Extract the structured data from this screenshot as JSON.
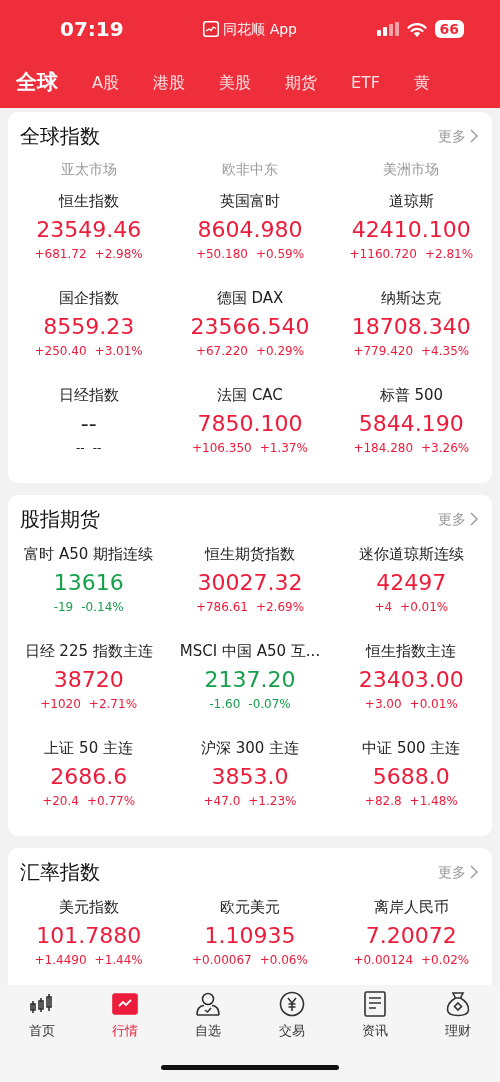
{
  "status_bar": {
    "time": "07:19",
    "app": "同花顺 App",
    "battery": "66"
  },
  "market_tabs": [
    {
      "label": "全球",
      "selected": true
    },
    {
      "label": "A股",
      "selected": false
    },
    {
      "label": "港股",
      "selected": false
    },
    {
      "label": "美股",
      "selected": false
    },
    {
      "label": "期货",
      "selected": false
    },
    {
      "label": "ETF",
      "selected": false
    },
    {
      "label": "黄",
      "selected": false
    }
  ],
  "sections": [
    {
      "title": "全球指数",
      "more": "更多",
      "regions": [
        "亚太市场",
        "欧非中东",
        "美洲市场"
      ],
      "quotes": [
        {
          "name": "恒生指数",
          "value": "23549.46",
          "change": "+681.72",
          "pct": "+2.98%",
          "color": "#ec1c3a"
        },
        {
          "name": "英国富时",
          "value": "8604.980",
          "change": "+50.180",
          "pct": "+0.59%",
          "color": "#ec1c3a"
        },
        {
          "name": "道琼斯",
          "value": "42410.100",
          "change": "+1160.720",
          "pct": "+2.81%",
          "color": "#ec1c3a"
        },
        {
          "name": "国企指数",
          "value": "8559.23",
          "change": "+250.40",
          "pct": "+3.01%",
          "color": "#ec1c3a"
        },
        {
          "name": "德国 DAX",
          "value": "23566.540",
          "change": "+67.220",
          "pct": "+0.29%",
          "color": "#ec1c3a"
        },
        {
          "name": "纳斯达克",
          "value": "18708.340",
          "change": "+779.420",
          "pct": "+4.35%",
          "color": "#ec1c3a"
        },
        {
          "name": "日经指数",
          "value": "--",
          "change": "--",
          "pct": "--",
          "color": "#222222"
        },
        {
          "name": "法国 CAC",
          "value": "7850.100",
          "change": "+106.350",
          "pct": "+1.37%",
          "color": "#ec1c3a"
        },
        {
          "name": "标普 500",
          "value": "5844.190",
          "change": "+184.280",
          "pct": "+3.26%",
          "color": "#ec1c3a"
        }
      ]
    },
    {
      "title": "股指期货",
      "more": "更多",
      "quotes": [
        {
          "name": "富时 A50 期指连续",
          "value": "13616",
          "change": "-19",
          "pct": "-0.14%",
          "color": "#17a04b"
        },
        {
          "name": "恒生期货指数",
          "value": "30027.32",
          "change": "+786.61",
          "pct": "+2.69%",
          "color": "#ec1c3a"
        },
        {
          "name": "迷你道琼斯连续",
          "value": "42497",
          "change": "+4",
          "pct": "+0.01%",
          "color": "#ec1c3a"
        },
        {
          "name": "日经 225 指数主连",
          "value": "38720",
          "change": "+1020",
          "pct": "+2.71%",
          "color": "#ec1c3a"
        },
        {
          "name": "MSCI 中国 A50 互...",
          "value": "2137.20",
          "change": "-1.60",
          "pct": "-0.07%",
          "color": "#17a04b"
        },
        {
          "name": "恒生指数主连",
          "value": "23403.00",
          "change": "+3.00",
          "pct": "+0.01%",
          "color": "#ec1c3a"
        },
        {
          "name": "上证 50 主连",
          "value": "2686.6",
          "change": "+20.4",
          "pct": "+0.77%",
          "color": "#ec1c3a"
        },
        {
          "name": "沪深 300 主连",
          "value": "3853.0",
          "change": "+47.0",
          "pct": "+1.23%",
          "color": "#ec1c3a"
        },
        {
          "name": "中证 500 主连",
          "value": "5688.0",
          "change": "+82.8",
          "pct": "+1.48%",
          "color": "#ec1c3a"
        }
      ]
    },
    {
      "title": "汇率指数",
      "more": "更多",
      "quotes": [
        {
          "name": "美元指数",
          "value": "101.7880",
          "change": "+1.4490",
          "pct": "+1.44%",
          "color": "#ec1c3a"
        },
        {
          "name": "欧元美元",
          "value": "1.10935",
          "change": "+0.00067",
          "pct": "+0.06%",
          "color": "#ec1c3a"
        },
        {
          "name": "离岸人民币",
          "value": "7.20072",
          "change": "+0.00124",
          "pct": "+0.02%",
          "color": "#ec1c3a"
        }
      ]
    }
  ],
  "bottom_nav": [
    {
      "label": "首页",
      "selected": false
    },
    {
      "label": "行情",
      "selected": true
    },
    {
      "label": "自选",
      "selected": false
    },
    {
      "label": "交易",
      "selected": false
    },
    {
      "label": "资讯",
      "selected": false
    },
    {
      "label": "理财",
      "selected": false
    }
  ]
}
